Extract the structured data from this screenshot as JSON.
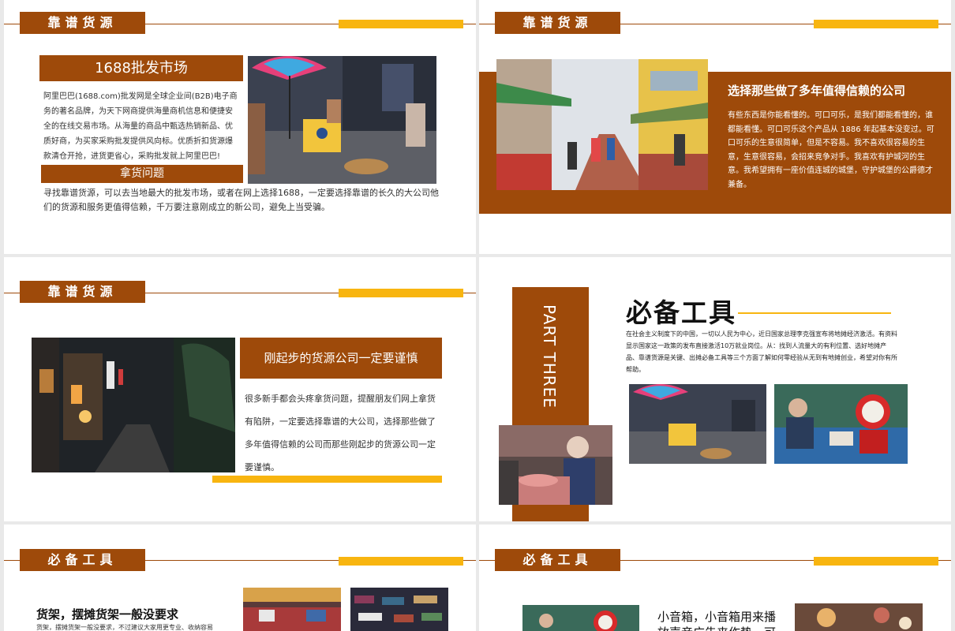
{
  "colors": {
    "brown": "#9e4a0a",
    "yellow": "#f8b510",
    "background": "#e9e9e9"
  },
  "slide1": {
    "tag": "靠谱货源",
    "box_title": "1688批发市场",
    "desc": "阿里巴巴(1688.com)批发网是全球企业间(B2B)电子商务的著名品牌，为天下网商提供海量商机信息和便捷安全的在线交易市场。从海量的商品中甄选热销新品、优质好商，为买家采购批发提供风向标。优质折扣货源爆款清仓开抢，进货更省心，采购批发就上阿里巴巴!",
    "sub_title": "拿货问题",
    "body": "寻找靠谱货源，可以去当地最大的批发市场，或者在网上选择1688，一定要选择靠谱的长久的大公司他们的货源和服务更值得信赖，千万要注意刚成立的新公司，避免上当受骗。"
  },
  "slide2": {
    "tag": "靠谱货源",
    "title": "选择那些做了多年值得信赖的公司",
    "body": "有些东西是你能看懂的。可口可乐，是我们都能看懂的，谁都能看懂。可口可乐这个产品从 1886 年起基本没变过。可口可乐的生意很简单，但是不容易。我不喜欢很容易的生意，生意很容易，会招来竞争对手。我喜欢有护城河的生意。我希望拥有一座价值连城的城堡，守护城堡的公爵德才兼备。"
  },
  "slide3": {
    "tag": "靠谱货源",
    "title": "刚起步的货源公司一定要谨慎",
    "body": "很多新手都会头疼拿货问题，提醒朋友们网上拿货有陷阱，一定要选择靠谱的大公司，选择那些做了多年值得信赖的公司而那些刚起步的货源公司一定要谨慎。"
  },
  "slide4": {
    "part": "PART THREE",
    "title": "必备工具",
    "body": "在社会主义制度下的中国，一切以人民为中心，近日国家总理李克强宣布将地摊经济激活。有资料显示国家这一政策的发布直接激活10万就业岗位。从：找到人流量大的有利位置、选好地摊产品、靠谱货源是关键、出摊必备工具等三个方面了解如何零经验从无到有地摊创业，希望对你有所帮助。"
  },
  "slide5": {
    "tag": "必备工具",
    "title": "货架，摆摊货架一般没要求",
    "body": "货架，摆摊货架一般没要求，不过建议大家用更专业、收纳容易"
  },
  "slide6": {
    "tag": "必备工具",
    "body": "小音箱，小音箱用来播放声音广告来作势，可"
  }
}
